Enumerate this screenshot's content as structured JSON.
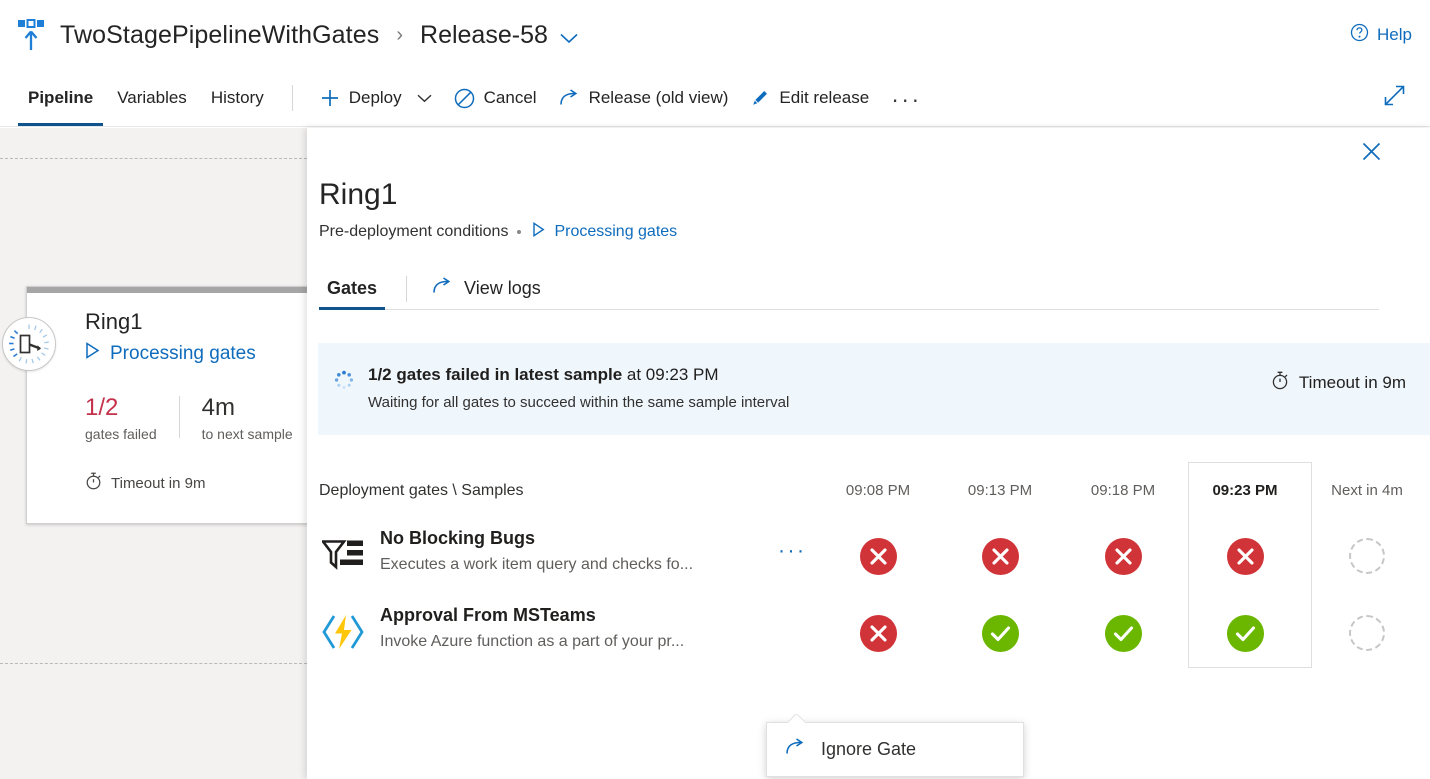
{
  "header": {
    "logo_icon": "release-pipeline-icon",
    "breadcrumb_root": "TwoStagePipelineWithGates",
    "breadcrumb_separator": "›",
    "breadcrumb_leaf": "Release-58",
    "chevron_icon": "chevron-down-icon",
    "help_label": "Help",
    "help_icon": "help-circle-icon"
  },
  "commandbar": {
    "tabs": [
      {
        "label": "Pipeline",
        "active": true
      },
      {
        "label": "Variables",
        "active": false
      },
      {
        "label": "History",
        "active": false
      }
    ],
    "actions": [
      {
        "label": "Deploy",
        "icon": "plus-icon",
        "has_chevron": true
      },
      {
        "label": "Cancel",
        "icon": "cancel-circle-icon",
        "has_chevron": false
      },
      {
        "label": "Release (old view)",
        "icon": "open-link-icon",
        "has_chevron": false
      },
      {
        "label": "Edit release",
        "icon": "pencil-icon",
        "has_chevron": false
      }
    ],
    "overflow_label": "···",
    "expand_icon": "fullscreen-expand-icon"
  },
  "canvas": {
    "stage_card": {
      "badge_icon": "gate-processing-icon",
      "name": "Ring1",
      "status_icon": "play-triangle-icon",
      "status_label": "Processing gates",
      "stat_failed_value": "1/2",
      "stat_failed_label": "gates failed",
      "stat_next_value": "4m",
      "stat_next_label": "to next sample",
      "timeout_icon": "stopwatch-icon",
      "timeout_label": "Timeout in 9m"
    }
  },
  "panel": {
    "close_icon": "close-icon",
    "title": "Ring1",
    "subtitle_prefix": "Pre-deployment conditions",
    "subtitle_status_icon": "play-triangle-icon",
    "subtitle_status_label": "Processing gates",
    "tabs": {
      "gates_label": "Gates",
      "view_logs_label": "View logs",
      "view_logs_icon": "open-link-icon"
    },
    "banner": {
      "spinner_icon": "loading-spinner-icon",
      "headline_bold": "1/2 gates failed in latest sample",
      "headline_rest": " at 09:23 PM",
      "detail": "Waiting for all gates to succeed within the same sample interval",
      "timeout_icon": "stopwatch-icon",
      "timeout_label": "Timeout in 9m",
      "background_color": "#eff6fc"
    },
    "table": {
      "row_header_label": "Deployment gates \\ Samples",
      "columns": [
        {
          "label": "09:08 PM",
          "current": false
        },
        {
          "label": "09:13 PM",
          "current": false
        },
        {
          "label": "09:18 PM",
          "current": false
        },
        {
          "label": "09:23 PM",
          "current": true
        },
        {
          "label": "Next in 4m",
          "current": false
        }
      ],
      "rows": [
        {
          "icon": "work-item-query-filter-icon",
          "name": "No Blocking Bugs",
          "description": "Executes a work item query and checks fo...",
          "more_label": "···",
          "results": [
            "fail",
            "fail",
            "fail",
            "fail",
            "pending"
          ]
        },
        {
          "icon": "azure-function-icon",
          "name": "Approval From MSTeams",
          "description": "Invoke Azure function as a part of your pr...",
          "more_label": "···",
          "results": [
            "fail",
            "pass",
            "pass",
            "pass",
            "pending"
          ]
        }
      ]
    },
    "callout": {
      "item_icon": "open-link-icon",
      "item_label": "Ignore Gate"
    }
  },
  "colors": {
    "accent_blue": "#0f6cbd",
    "tab_underline": "#0f548c",
    "fail_red": "#d13438",
    "pass_green": "#6bb700",
    "stat_red": "#c4314b",
    "banner_blue": "#eff6fc",
    "canvas_gray": "#f3f2f1"
  }
}
